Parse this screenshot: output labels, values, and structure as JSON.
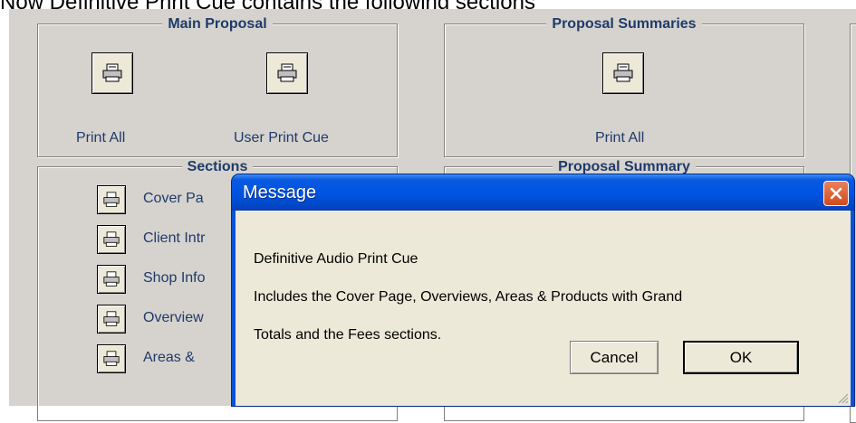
{
  "caption": "Now Definitive Print Cue contains the following sections",
  "main_proposal": {
    "title": "Main Proposal",
    "print_all": "Print All",
    "user_print_cue": "User Print Cue"
  },
  "proposal_summaries": {
    "title": "Proposal Summaries",
    "print_all": "Print All"
  },
  "sections": {
    "title": "Sections",
    "items": [
      "Cover Pa",
      "Client Intr",
      "Shop Info",
      "Overview",
      "Areas & "
    ]
  },
  "proposal_summary": {
    "title": "Proposal Summary"
  },
  "dialog": {
    "title": "Message",
    "line1": "Definitive Audio Print Cue",
    "line2": "Includes the Cover Page, Overviews, Areas & Products with Grand",
    "line3": "Totals and the Fees sections.",
    "cancel": "Cancel",
    "ok": "OK"
  },
  "colors": {
    "label": "#1f3a6b",
    "titlebar": "#0054e3",
    "close": "#d24b1c"
  },
  "icons": {
    "print": "printer-icon",
    "close": "close-icon"
  }
}
